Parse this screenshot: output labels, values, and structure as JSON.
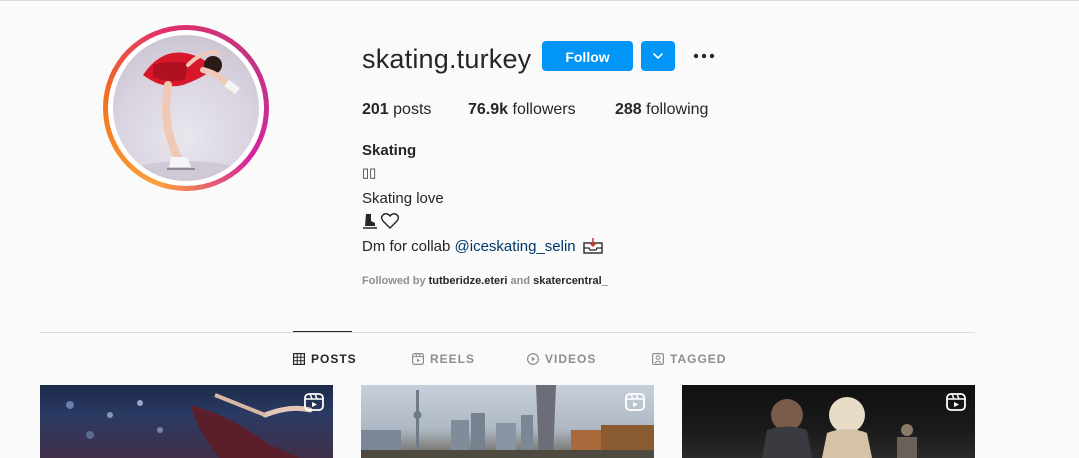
{
  "profile": {
    "username": "skating.turkey",
    "follow_label": "Follow",
    "stats": {
      "posts_count": "201",
      "posts_label": "posts",
      "followers_count": "76.9k",
      "followers_label": "followers",
      "following_count": "288",
      "following_label": "following"
    },
    "bio": {
      "name": "Skating",
      "line1": "▯▯",
      "line2": "Skating love",
      "line4_prefix": "Dm for collab ",
      "mention": "@iceskating_selin"
    },
    "followed_by": {
      "prefix": "Followed by ",
      "user1": "tutberidze.eteri",
      "and": " and ",
      "user2": "skatercentral_"
    }
  },
  "tabs": [
    {
      "label": "POSTS",
      "icon": "grid-icon",
      "active": true
    },
    {
      "label": "REELS",
      "icon": "reels-icon",
      "active": false
    },
    {
      "label": "VIDEOS",
      "icon": "play-icon",
      "active": false
    },
    {
      "label": "TAGGED",
      "icon": "tagged-icon",
      "active": false
    }
  ],
  "colors": {
    "accent": "#0095f6",
    "text": "#262626",
    "muted": "#8e8e8e",
    "link": "#00376b"
  }
}
